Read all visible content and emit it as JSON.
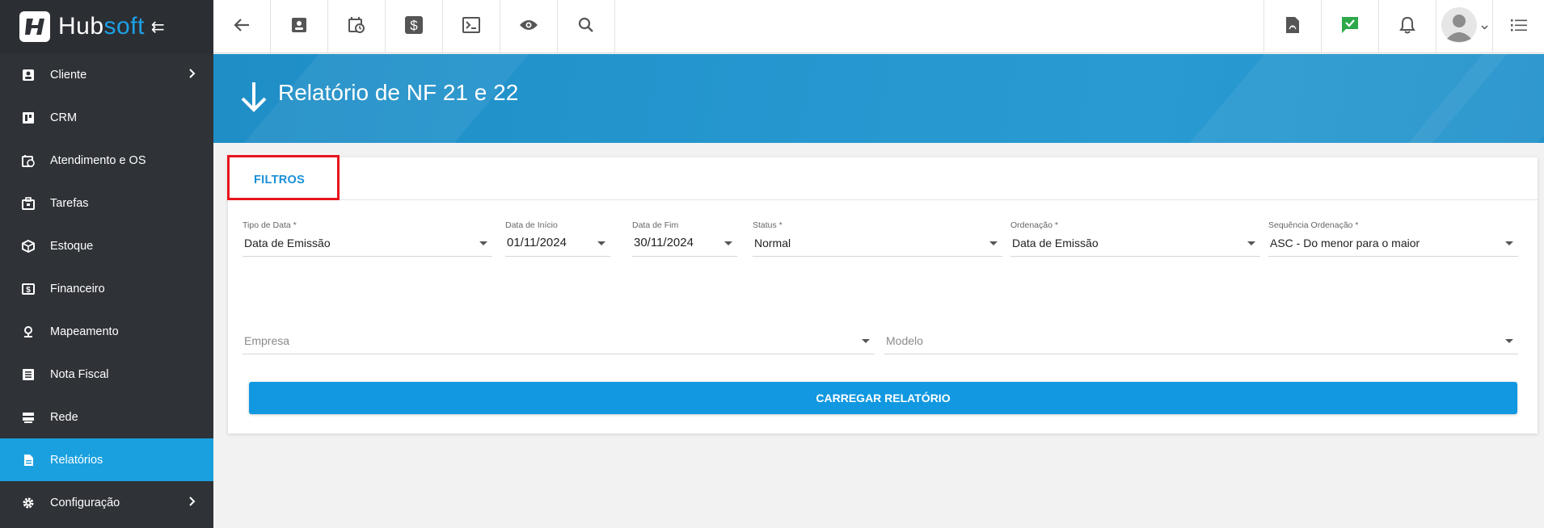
{
  "brand": {
    "name_a": "Hub",
    "name_b": "soft"
  },
  "sidebar": {
    "items": [
      {
        "label": "Cliente",
        "icon": "contact-card-icon",
        "has_chevron": true
      },
      {
        "label": "CRM",
        "icon": "kanban-icon"
      },
      {
        "label": "Atendimento e OS",
        "icon": "calendar-clock-icon"
      },
      {
        "label": "Tarefas",
        "icon": "briefcase-icon"
      },
      {
        "label": "Estoque",
        "icon": "box-icon"
      },
      {
        "label": "Financeiro",
        "icon": "money-icon"
      },
      {
        "label": "Mapeamento",
        "icon": "map-pin-icon"
      },
      {
        "label": "Nota Fiscal",
        "icon": "document-lines-icon"
      },
      {
        "label": "Rede",
        "icon": "server-icon"
      },
      {
        "label": "Relatórios",
        "icon": "file-icon",
        "active": true
      },
      {
        "label": "Configuração",
        "icon": "gear-icon",
        "has_chevron": true
      }
    ]
  },
  "header": {
    "title": "Relatório de NF 21 e 22"
  },
  "tabs": {
    "filtros": "FILTROS"
  },
  "filters": {
    "tipo_data": {
      "label": "Tipo de Data *",
      "value": "Data de Emissão"
    },
    "data_inicio": {
      "label": "Data de Início",
      "value": "01/11/2024"
    },
    "data_fim": {
      "label": "Data de Fim",
      "value": "30/11/2024"
    },
    "status": {
      "label": "Status *",
      "value": "Normal"
    },
    "ordenacao": {
      "label": "Ordenação *",
      "value": "Data de Emissão"
    },
    "sequencia": {
      "label": "Sequência Ordenação *",
      "value": "ASC - Do menor para o maior"
    },
    "empresa": {
      "placeholder": "Empresa"
    },
    "modelo": {
      "placeholder": "Modelo"
    }
  },
  "actions": {
    "load": "CARREGAR RELATÓRIO"
  },
  "colors": {
    "sidebar": "#2f3237",
    "accent": "#1aa0df",
    "highlight": "#e8141d",
    "button": "#1198e1"
  }
}
